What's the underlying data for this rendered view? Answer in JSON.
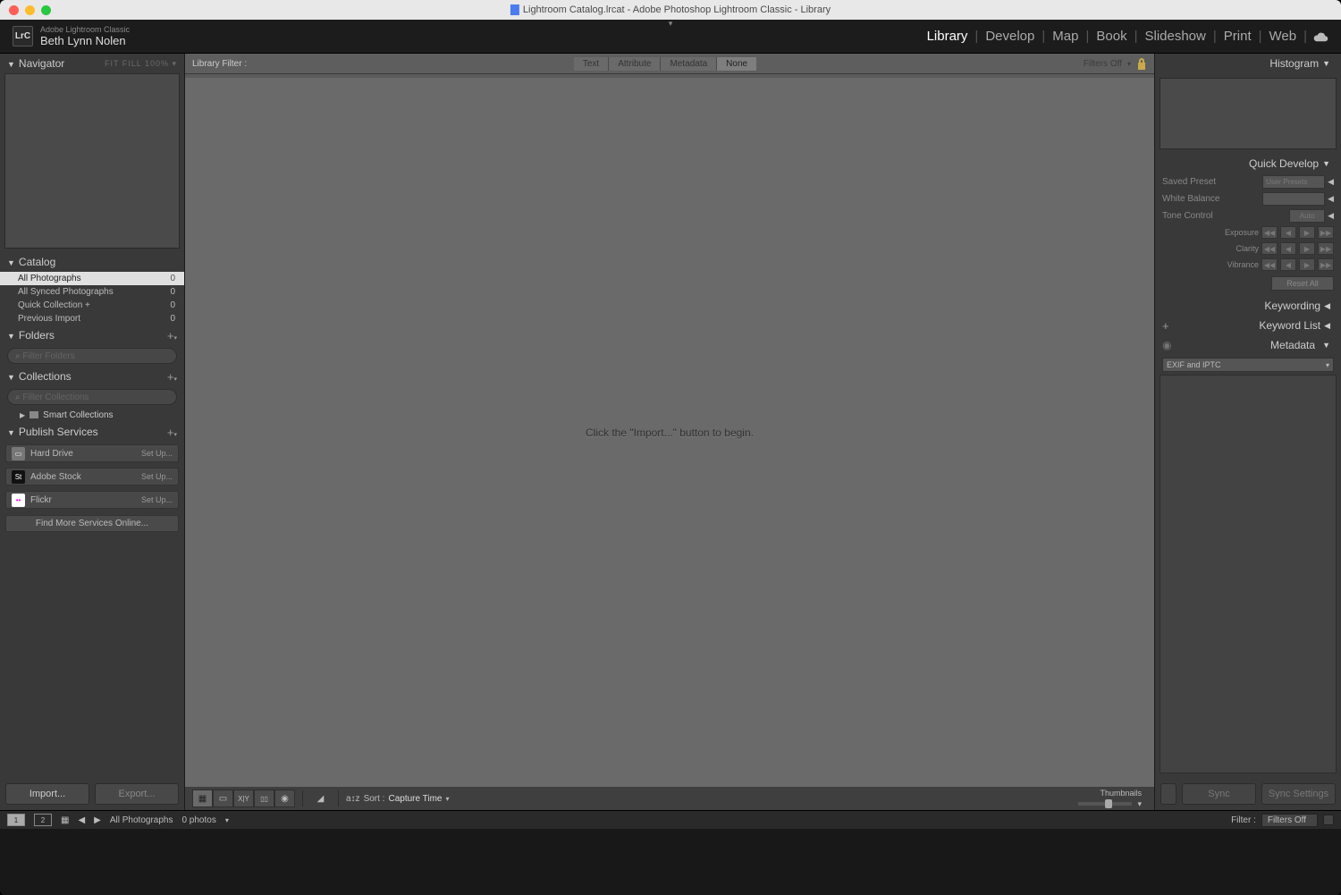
{
  "titlebar": {
    "title": "Lightroom Catalog.lrcat - Adobe Photoshop Lightroom Classic - Library"
  },
  "identity": {
    "badge": "LrC",
    "app": "Adobe Lightroom Classic",
    "user": "Beth Lynn Nolen"
  },
  "modules": {
    "library": "Library",
    "develop": "Develop",
    "map": "Map",
    "book": "Book",
    "slideshow": "Slideshow",
    "print": "Print",
    "web": "Web"
  },
  "left": {
    "navigator": {
      "title": "Navigator",
      "modes": "FIT  FILL  100%  ▾"
    },
    "catalog": {
      "title": "Catalog",
      "rows": [
        {
          "label": "All Photographs",
          "count": "0"
        },
        {
          "label": "All Synced Photographs",
          "count": "0"
        },
        {
          "label": "Quick Collection  +",
          "count": "0"
        },
        {
          "label": "Previous Import",
          "count": "0"
        }
      ]
    },
    "folders": {
      "title": "Folders",
      "placeholder": "Filter Folders"
    },
    "collections": {
      "title": "Collections",
      "placeholder": "Filter Collections",
      "smart": "Smart Collections"
    },
    "publish": {
      "title": "Publish Services",
      "rows": [
        {
          "name": "Hard Drive",
          "setup": "Set Up..."
        },
        {
          "name": "Adobe Stock",
          "setup": "Set Up..."
        },
        {
          "name": "Flickr",
          "setup": "Set Up..."
        }
      ],
      "find_more": "Find More Services Online..."
    },
    "import_btn": "Import...",
    "export_btn": "Export..."
  },
  "center": {
    "filterbar": {
      "label": "Library Filter :",
      "text": "Text",
      "attribute": "Attribute",
      "metadata": "Metadata",
      "none": "None",
      "filters_off": "Filters Off"
    },
    "empty_msg": "Click the \"Import...\" button to begin.",
    "toolbar": {
      "sort_label": "Sort :",
      "sort_value": "Capture Time",
      "thumbnails": "Thumbnails"
    }
  },
  "right": {
    "histogram": "Histogram",
    "quick_develop": {
      "title": "Quick Develop",
      "saved_preset": "Saved Preset",
      "saved_preset_val": "User Presets",
      "white_balance": "White Balance",
      "tone_control": "Tone Control",
      "auto": "Auto",
      "exposure": "Exposure",
      "clarity": "Clarity",
      "vibrance": "Vibrance",
      "reset": "Reset All"
    },
    "keywording": "Keywording",
    "keyword_list": "Keyword List",
    "metadata": "Metadata",
    "metadata_preset": "EXIF and IPTC",
    "sync": "Sync",
    "sync_settings": "Sync Settings"
  },
  "filmstrip": {
    "breadcrumb": "All Photographs",
    "count": "0 photos",
    "filter_label": "Filter :",
    "filter_value": "Filters Off"
  }
}
